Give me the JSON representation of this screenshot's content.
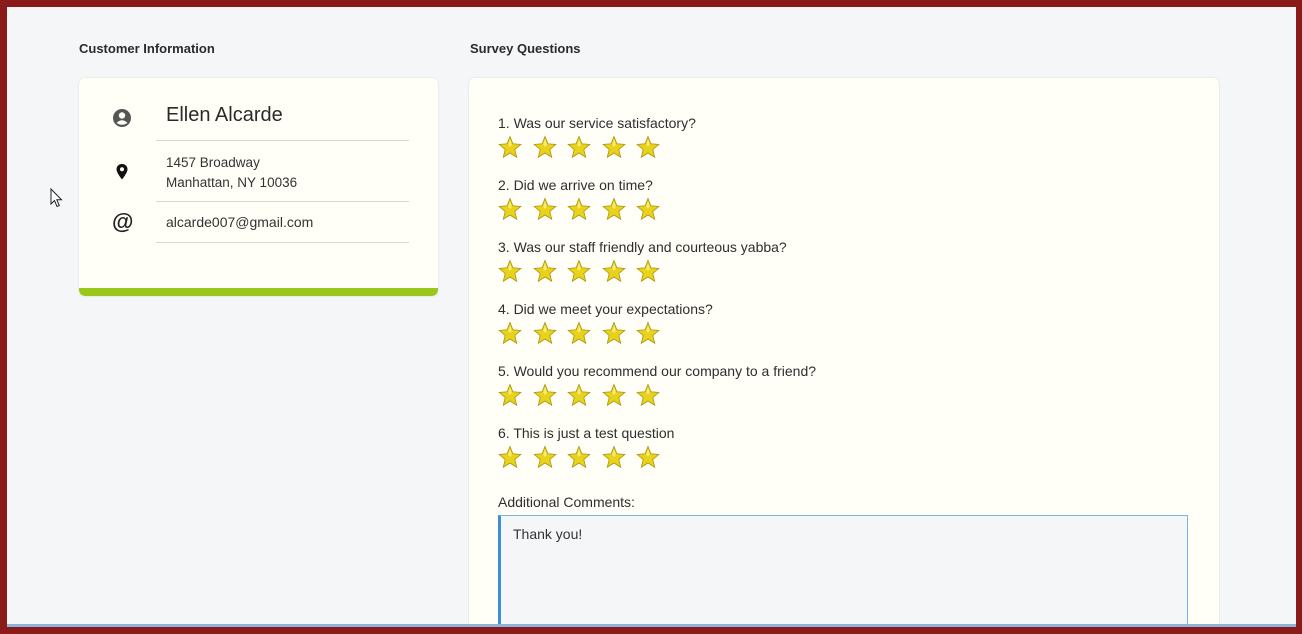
{
  "customer_section": {
    "title": "Customer Information",
    "name": "Ellen Alcarde",
    "address_line1": "1457 Broadway",
    "address_line2": "Manhattan, NY 10036",
    "email": "alcarde007@gmail.com",
    "icons": [
      "user-circle-icon",
      "map-pin-icon",
      "at-sign-icon"
    ],
    "accent_color": "#99c71a"
  },
  "survey_section": {
    "title": "Survey Questions",
    "questions": [
      {
        "text": "1. Was our service satisfactory?",
        "stars": 5
      },
      {
        "text": "2. Did we arrive on time?",
        "stars": 5
      },
      {
        "text": "3. Was our staff friendly and courteous yabba?",
        "stars": 5
      },
      {
        "text": "4. Did we meet your expectations?",
        "stars": 5
      },
      {
        "text": "5. Would you recommend our company to a friend?",
        "stars": 5
      },
      {
        "text": "6. This is just a test question",
        "stars": 5
      }
    ],
    "comments_label": "Additional Comments:",
    "comments_value": "Thank you!",
    "star_color": "#e8d21a"
  }
}
